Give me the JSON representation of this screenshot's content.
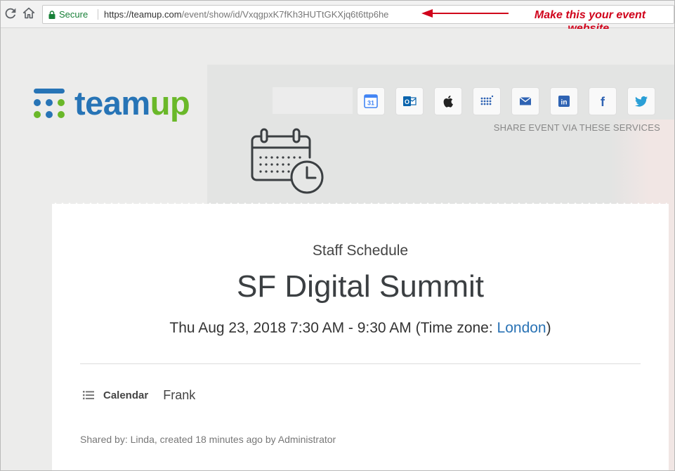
{
  "browser": {
    "secure_label": "Secure",
    "url_origin": "https://teamup.com",
    "url_path": "/event/show/id/VxqgpxK7fKh3HUTtGKXjq6t6ttp6he"
  },
  "annotation": {
    "text": "Make this your event website.",
    "color": "#d0021b"
  },
  "logo": {
    "part1": "team",
    "part2": "up",
    "colors": {
      "team": "#2774b6",
      "up": "#6ab829"
    }
  },
  "share": {
    "caption": "SHARE EVENT VIA THESE SERVICES",
    "buttons": [
      {
        "icon": "google-calendar-icon",
        "label": "31"
      },
      {
        "icon": "outlook-icon",
        "label": "O"
      },
      {
        "icon": "apple-icon"
      },
      {
        "icon": "ical-icon"
      },
      {
        "icon": "email-icon"
      },
      {
        "icon": "linkedin-icon",
        "label": "in"
      },
      {
        "icon": "facebook-icon",
        "label": "f"
      },
      {
        "icon": "twitter-icon"
      }
    ]
  },
  "event": {
    "calendar_name": "Staff Schedule",
    "title": "SF Digital Summit",
    "time_prefix": "Thu Aug 23, 2018 7:30 AM - 9:30 AM (Time zone: ",
    "timezone": "London",
    "time_suffix": ")",
    "calendar_label": "Calendar",
    "calendar_value": "Frank",
    "shared_by": "Shared by: Linda, created 18 minutes ago by Administrator"
  },
  "colors": {
    "link": "#2a73b5",
    "secure_green": "#188038"
  }
}
